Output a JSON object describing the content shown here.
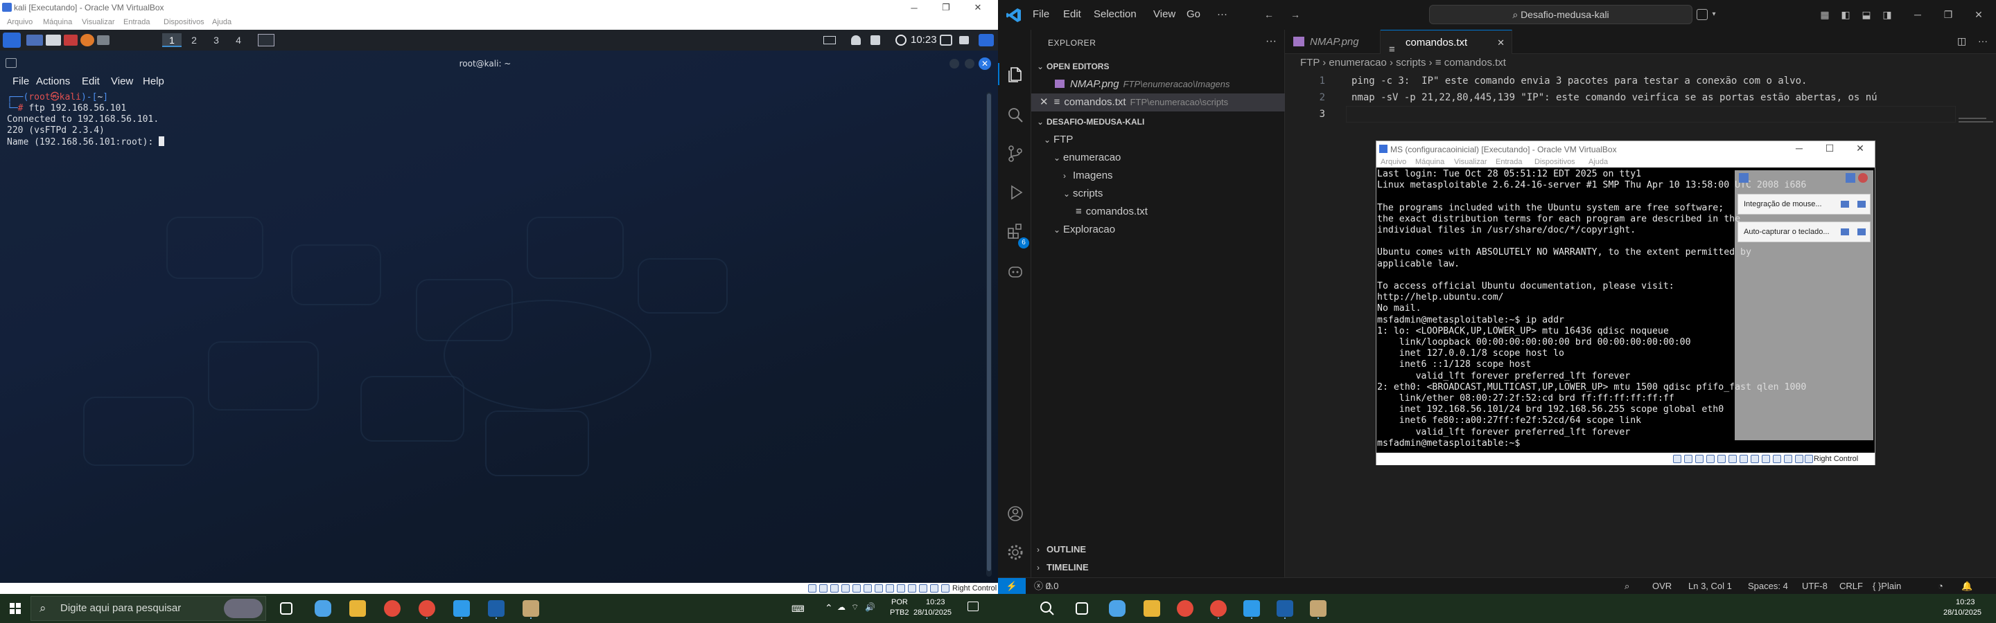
{
  "left_vm": {
    "title": "kali [Executando] - Oracle VM VirtualBox",
    "menu": [
      "Arquivo",
      "Máquina",
      "Visualizar",
      "Entrada",
      "Dispositivos",
      "Ajuda"
    ],
    "panel": {
      "workspaces": [
        "1",
        "2",
        "3",
        "4"
      ],
      "clock": "10:23"
    },
    "terminal": {
      "title": "root@kali: ~",
      "menu": [
        "File",
        "Actions",
        "Edit",
        "View",
        "Help"
      ],
      "prompt_user": "root",
      "prompt_host": "kali",
      "prompt_dir": "~",
      "command": "ftp 192.168.56.101",
      "output": [
        "Connected to 192.168.56.101.",
        "220 (vsFTPd 2.3.4)",
        "Name (192.168.56.101:root): "
      ]
    },
    "status_right": "Right Control"
  },
  "vscode": {
    "menu": [
      "File",
      "Edit",
      "Selection",
      "View",
      "Go"
    ],
    "more": "···",
    "search_text": "Desafio-medusa-kali",
    "explorer_title": "EXPLORER",
    "open_editors_label": "OPEN EDITORS",
    "open_editors": [
      {
        "name": "NMAP.png",
        "path": "FTP\\enumeracao\\Imagens"
      },
      {
        "name": "comandos.txt",
        "path": "FTP\\enumeracao\\scripts"
      }
    ],
    "workspace_label": "DESAFIO-MEDUSA-KALI",
    "tree": [
      "FTP",
      "enumeracao",
      "Imagens",
      "scripts",
      "comandos.txt",
      "Exploracao"
    ],
    "outline_label": "OUTLINE",
    "timeline_label": "TIMELINE",
    "badge": "6",
    "tabs": [
      "NMAP.png",
      "comandos.txt"
    ],
    "breadcrumb": [
      "FTP",
      "enumeracao",
      "scripts",
      "comandos.txt"
    ],
    "lines": [
      {
        "n": "1",
        "text": "ping -c 3:  IP\" este comando envia 3 pacotes para testar a conexão com o alvo."
      },
      {
        "n": "2",
        "text": "nmap -sV -p 21,22,80,445,139 \"IP\": este comando veirfica se as portas estão abertas, os nú"
      },
      {
        "n": "3",
        "text": ""
      }
    ],
    "status": {
      "errors": "0",
      "warnings": "0",
      "ovr": "OVR",
      "position": "Ln 3, Col 1",
      "spaces": "Spaces: 4",
      "encoding": "UTF-8",
      "eol": "CRLF",
      "language": "Plain Text"
    }
  },
  "ms_vm": {
    "title": "MS (configuracaoinicial) [Executando] - Oracle VM VirtualBox",
    "menu": [
      "Arquivo",
      "Máquina",
      "Visualizar",
      "Entrada",
      "Dispositivos",
      "Ajuda"
    ],
    "console": [
      "Last login: Tue Oct 28 05:51:12 EDT 2025 on tty1",
      "Linux metasploitable 2.6.24-16-server #1 SMP Thu Apr 10 13:58:00 UTC 2008 i686",
      "",
      "The programs included with the Ubuntu system are free software;",
      "the exact distribution terms for each program are described in the",
      "individual files in /usr/share/doc/*/copyright.",
      "",
      "Ubuntu comes with ABSOLUTELY NO WARRANTY, to the extent permitted by",
      "applicable law.",
      "",
      "To access official Ubuntu documentation, please visit:",
      "http://help.ubuntu.com/",
      "No mail.",
      "msfadmin@metasploitable:~$ ip addr",
      "1: lo: <LOOPBACK,UP,LOWER_UP> mtu 16436 qdisc noqueue",
      "    link/loopback 00:00:00:00:00:00 brd 00:00:00:00:00:00",
      "    inet 127.0.0.1/8 scope host lo",
      "    inet6 ::1/128 scope host",
      "       valid_lft forever preferred_lft forever",
      "2: eth0: <BROADCAST,MULTICAST,UP,LOWER_UP> mtu 1500 qdisc pfifo_fast qlen 1000",
      "    link/ether 08:00:27:2f:52:cd brd ff:ff:ff:ff:ff:ff",
      "    inet 192.168.56.101/24 brd 192.168.56.255 scope global eth0",
      "    inet6 fe80::a00:27ff:fe2f:52cd/64 scope link",
      "       valid_lft forever preferred_lft forever",
      "msfadmin@metasploitable:~$"
    ],
    "notifications": [
      "Integração de mouse...",
      "Auto-capturar o teclado..."
    ],
    "status_right": "Right Control"
  },
  "taskbar": {
    "search_placeholder": "Digite aqui para pesquisar",
    "lang1": "POR",
    "lang2": "PTB2",
    "time_left": "10:23",
    "date_left": "28/10/2025",
    "time_right": "10:23",
    "date_right": "28/10/2025"
  },
  "colors": {
    "accent": "#0078d4",
    "kali_red": "#e05050",
    "kali_blue": "#4c8ff0",
    "taskbar": "#1c2f1e"
  }
}
